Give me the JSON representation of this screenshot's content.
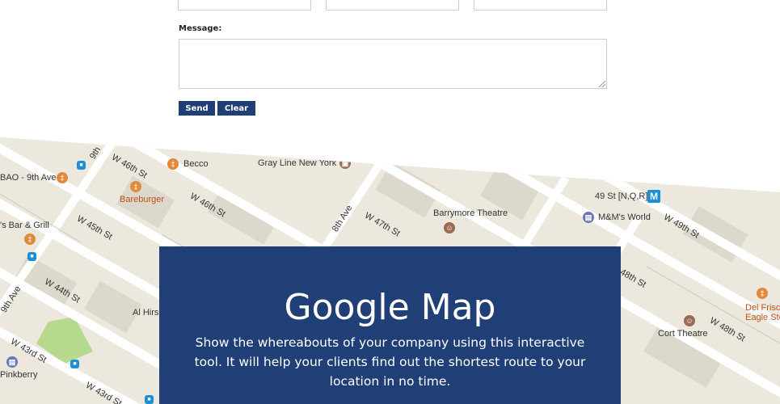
{
  "form": {
    "message_label": "Message:",
    "send_label": "Send",
    "clear_label": "Clear"
  },
  "map": {
    "streets": [
      "W 46th St",
      "W 46th St",
      "W 45th St",
      "W 44th St",
      "W 43rd St",
      "W 43rd St",
      "W 47th St",
      "W 49th St",
      "W 48th St",
      "8th Ave",
      "9th Ave",
      "9th",
      "48th St"
    ],
    "places": [
      "Becco",
      "Gray Line New York",
      "Barrymore Theatre",
      "49 St [N,Q,R]",
      "M&M's World",
      "BAO - 9th Ave",
      "Bareburger",
      "'s Bar & Grill",
      "Al Hirs",
      "Del Frisc",
      "Eagle Ste",
      "Cort Theatre",
      "Pinkberry"
    ],
    "metro_symbol": "M"
  },
  "panel": {
    "title": "Google Map",
    "description": "Show the whereabouts of your company using this interactive tool. It will help your clients find out the shortest route to your location in no time."
  },
  "colors": {
    "accent": "#213f77",
    "map_bg": "#ece8de",
    "road": "#ffffff",
    "park": "#b6d98e"
  }
}
